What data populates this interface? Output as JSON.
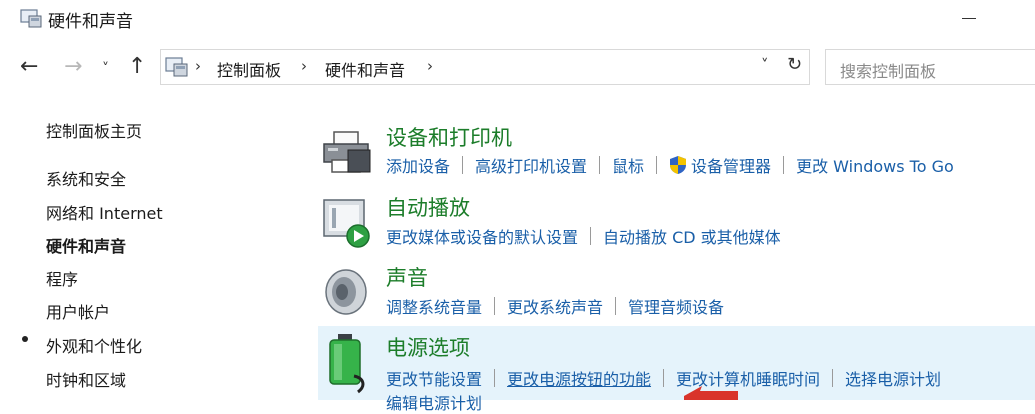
{
  "window": {
    "title": "硬件和声音"
  },
  "address": {
    "crumbs": [
      "控制面板",
      "硬件和声音"
    ],
    "search_placeholder": "搜索控制面板"
  },
  "leftnav": {
    "home": "控制面板主页",
    "items": [
      "系统和安全",
      "网络和 Internet",
      "硬件和声音",
      "程序",
      "用户帐户",
      "外观和个性化",
      "时钟和区域"
    ],
    "current_index": 2
  },
  "categories": [
    {
      "title": "设备和打印机",
      "icon": "printer-icon",
      "links": [
        "添加设备",
        "高级打印机设置",
        "鼠标",
        "设备管理器",
        "更改 Windows To Go"
      ]
    },
    {
      "title": "自动播放",
      "icon": "autoplay-icon",
      "links": [
        "更改媒体或设备的默认设置",
        "自动播放 CD 或其他媒体"
      ]
    },
    {
      "title": "声音",
      "icon": "speaker-icon",
      "links": [
        "调整系统音量",
        "更改系统声音",
        "管理音频设备"
      ]
    },
    {
      "title": "电源选项",
      "icon": "battery-icon",
      "links": [
        "更改节能设置",
        "更改电源按钮的功能",
        "更改计算机睡眠时间",
        "选择电源计划"
      ],
      "links_row2": [
        "编辑电源计划"
      ]
    }
  ],
  "colors": {
    "category_title": "#1c7d2a",
    "link": "#1a5fa8",
    "highlight_bg": "#e5f3fb",
    "annotation_arrow": "#d9342b"
  }
}
